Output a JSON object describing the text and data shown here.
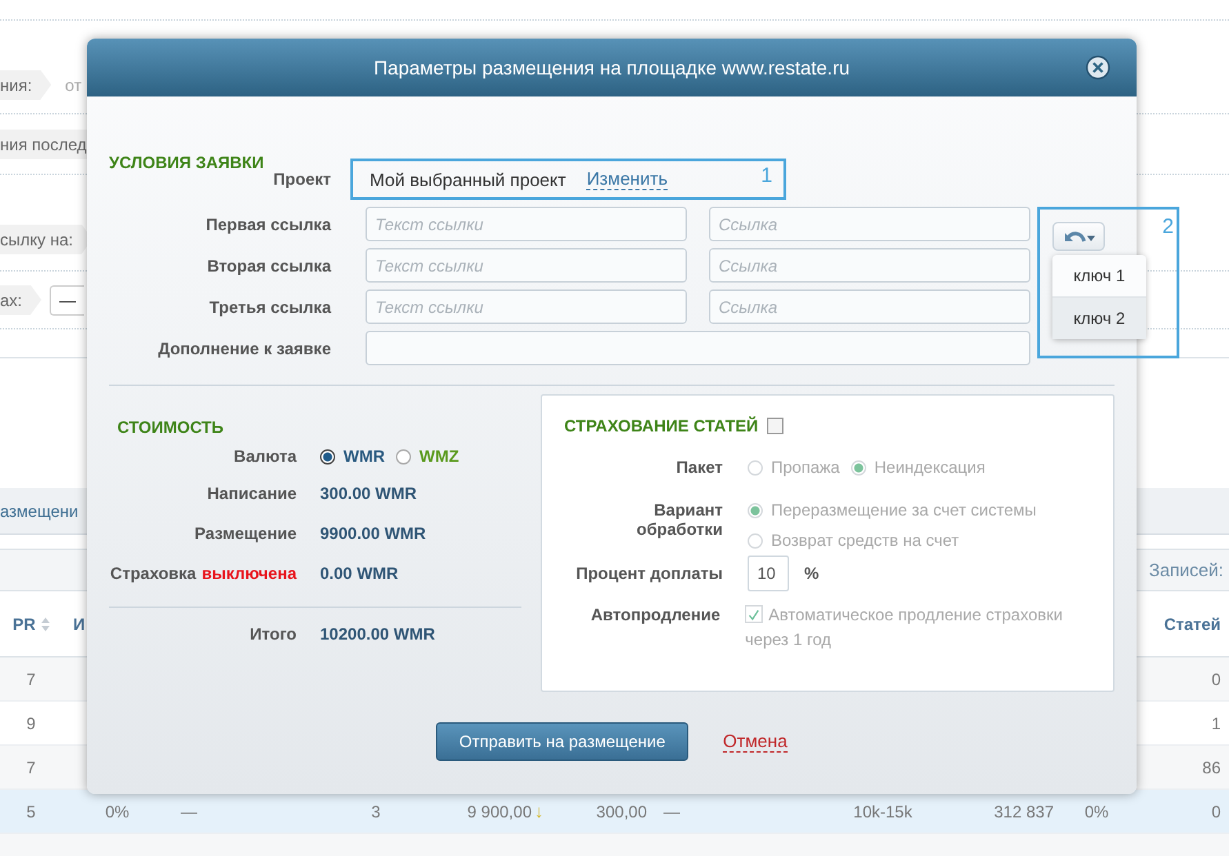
{
  "page": {
    "filters": [
      {
        "label": "ния:",
        "value": "от"
      },
      {
        "label": "ния послед"
      },
      {
        "label": "сылку на:"
      },
      {
        "label": "ах:",
        "field": "—"
      }
    ],
    "tab": "азмещени",
    "records_label": "Записей:",
    "table": {
      "columns": [
        {
          "label": "PR",
          "sortable": true
        },
        {
          "label": "И",
          "sortable": false
        },
        {
          "label": "Статей",
          "sortable": false
        }
      ],
      "rows": [
        {
          "kind": "partial",
          "selected": false,
          "pr": "7",
          "articles": "0"
        },
        {
          "kind": "partial",
          "selected": false,
          "pr": "9",
          "articles": "1"
        },
        {
          "kind": "partial",
          "selected": false,
          "pr": "7",
          "articles": "86"
        },
        {
          "kind": "full",
          "selected": true,
          "trend": "↓",
          "cells": [
            "5",
            "0%",
            "—",
            "3",
            "9 900,00",
            "300,00",
            "—",
            "10k-15k",
            "312 837",
            "0%",
            "0"
          ]
        }
      ]
    }
  },
  "dialog": {
    "title": "Параметры размещения на площадке www.restate.ru",
    "request": {
      "heading": "УСЛОВИЯ ЗАЯВКИ",
      "project": {
        "label": "Проект",
        "value": "Мой выбранный проект",
        "link": "Изменить",
        "marker": "1"
      },
      "links": [
        {
          "label": "Первая ссылка",
          "text_placeholder": "Текст ссылки",
          "url_placeholder": "Ссылка"
        },
        {
          "label": "Вторая ссылка",
          "text_placeholder": "Текст ссылки",
          "url_placeholder": "Ссылка"
        },
        {
          "label": "Третья ссылка",
          "text_placeholder": "Текст ссылки",
          "url_placeholder": "Ссылка"
        }
      ],
      "addition": {
        "label": "Дополнение к заявке"
      },
      "keys": {
        "marker": "2",
        "items": [
          {
            "label": "ключ 1",
            "selected": false
          },
          {
            "label": "ключ 2",
            "selected": true
          }
        ]
      }
    },
    "cost": {
      "heading": "СТОИМОСТЬ",
      "currency": {
        "label": "Валюта",
        "options": [
          {
            "label": "WMR",
            "selected": true,
            "color": "#2a5a80"
          },
          {
            "label": "WMZ",
            "selected": false,
            "color": "#5a9a1e"
          }
        ]
      },
      "lines": [
        {
          "label": "Написание",
          "value": "300.00 WMR"
        },
        {
          "label": "Размещение",
          "value": "9900.00 WMR"
        },
        {
          "label": "Страховка",
          "status": "выключена",
          "status_on": false,
          "value": "0.00 WMR"
        }
      ],
      "total": {
        "label": "Итого",
        "value": "10200.00 WMR"
      }
    },
    "insurance": {
      "heading": "СТРАХОВАНИЕ СТАТЕЙ",
      "checked": false,
      "package": {
        "label": "Пакет",
        "options": [
          {
            "label": "Пропажа",
            "selected": false
          },
          {
            "label": "Неиндексация",
            "selected": true
          }
        ]
      },
      "handling": {
        "label": "Вариант обработки",
        "options": [
          {
            "label": "Переразмещение за счет системы",
            "selected": true
          },
          {
            "label": "Возврат средств на счет",
            "selected": false
          }
        ]
      },
      "surcharge": {
        "label": "Процент доплаты",
        "value": "10",
        "unit": "%"
      },
      "renewal": {
        "label": "Автопродление",
        "checked": true,
        "text": "Автоматическое продление страховки через 1 год"
      }
    },
    "submit": "Отправить на размещение",
    "cancel": "Отмена"
  }
}
